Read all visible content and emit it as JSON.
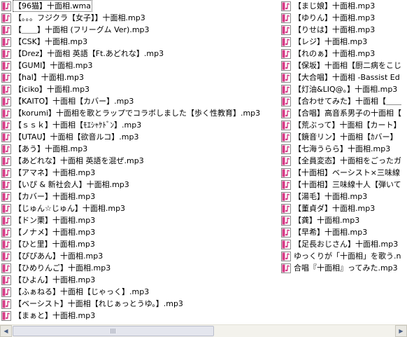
{
  "icon": {
    "name": "mp3-audio-file-icon",
    "color": "#d63a86"
  },
  "files": {
    "left": [
      "【96猫】十面相.wma",
      "【。。。フジクラ【女子】】十面相.mp3",
      "【＿＿】十面相 (フリーグム Ver).mp3",
      "【CSK】十面相.mp3",
      "【Drez】十面相 英語【Ft.あどれな】.mp3",
      "【GUMI】十面相.mp3",
      "【hal】十面相.mp3",
      "【iciko】十面相.mp3",
      "【KAITO】十面相【カバー】.mp3",
      "【korumi】十面相を歌とラップでコラボしました【歩く性教育】.mp3",
      "【ｓｓｋ】十面相【ﾓｴｼｬｹﾄﾞﾝ】.mp3",
      "【UTAU】十面相【欲音ルコ】.mp3",
      "【あう】十面相.mp3",
      "【あどれな】十面相 英語を混ぜ.mp3",
      "【アマネ】十面相.mp3",
      "【いぴ & 新社会人】十面相.mp3",
      "【カバー】十面相.mp3",
      "【じゅん☆じゅん】十面相.mp3",
      "【ドン栗】十面相.mp3",
      "【ノナメ】十面相.mp3",
      "【ひと里】十面相.mp3",
      "【ぴぴあん】十面相.mp3",
      "【ひめりんご】十面相.mp3",
      "【ひよん】十面相.mp3",
      "【ふぁねる】十面相【じゃっく】.mp3",
      "【ベーシスト】十面相【れじぁっとうゆ。】.mp3",
      "【まぁと】十面相.mp3"
    ],
    "right": [
      "【まじ娘】十面相.mp3",
      "【ゆりん】十面相.mp3",
      "【りせは】十面相.mp3",
      "【レジ】十面相.mp3",
      "【れのぁ】十面相.mp3",
      "【保坂】十面相【厨二病をこじ",
      "【大合唱】十面相 -Bassist Ed",
      "【灯油&LIQ@。】十面相.mp3",
      "【合わせてみた】十面相【＿＿",
      "【合唱】高音系男子の十面相【",
      "【荒ぶって】十面相【カート】",
      "【鏡音リン】十面相【ｶバー】",
      "【七海うらら】十面相.mp3",
      "【全員変态】十面相をごったガ",
      "【十面相】ベーシスト×三味線",
      "【十面相】三味線十人【弾いて",
      "【湯毛】十面相.mp3",
      "【董貞ダ】十面相.mp3",
      "【龚】十面相.mp3",
      "【早希】十面相.mp3",
      "【足長おじさん】十面相.mp3",
      "ゆっくりが「十面相」を歌う.n",
      "合唱『十面相』ってみた.mp3"
    ]
  },
  "scrollbar": {
    "left_arrow": "◀",
    "right_arrow": "▶"
  }
}
